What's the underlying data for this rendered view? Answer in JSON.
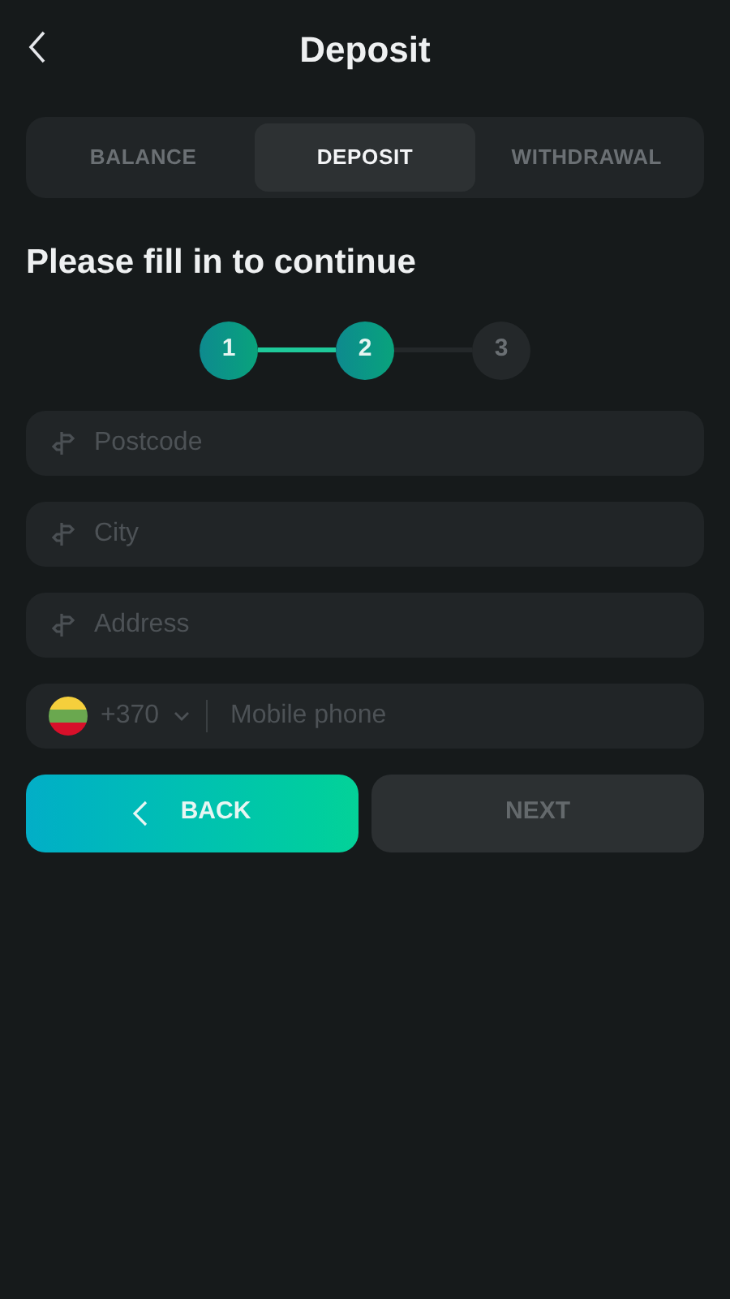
{
  "header": {
    "title": "Deposit"
  },
  "tabs": [
    {
      "label": "BALANCE",
      "selected": false
    },
    {
      "label": "DEPOSIT",
      "selected": true
    },
    {
      "label": "WITHDRAWAL",
      "selected": false
    }
  ],
  "heading": "Please fill in to continue",
  "steps": [
    {
      "label": "1",
      "active": true
    },
    {
      "label": "2",
      "active": true
    },
    {
      "label": "3",
      "active": false
    }
  ],
  "fields": [
    {
      "placeholder": "Postcode"
    },
    {
      "placeholder": "City"
    },
    {
      "placeholder": "Address"
    }
  ],
  "phone": {
    "code": "+370",
    "placeholder": "Mobile phone"
  },
  "buttons": {
    "back": {
      "label": "BACK"
    },
    "next": {
      "label": "NEXT",
      "disabled": true
    }
  }
}
